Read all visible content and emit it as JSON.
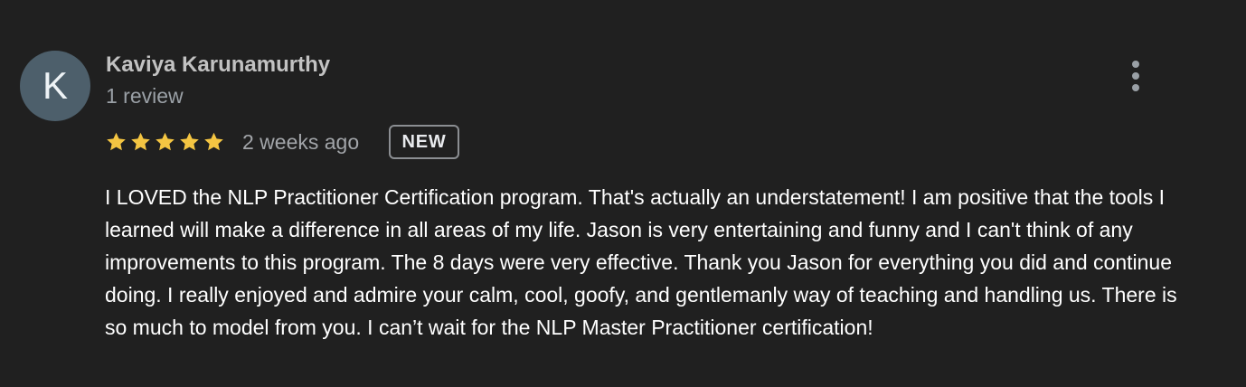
{
  "review": {
    "reviewer": {
      "avatar_letter": "K",
      "name": "Kaviya Karunamurthy",
      "review_count": "1 review"
    },
    "rating": {
      "stars": 5,
      "max_stars": 5,
      "star_color": "#f4c542"
    },
    "date": "2 weeks ago",
    "badge": "NEW",
    "text": "I LOVED the NLP Practitioner Certification program. That's actually an understatement! I am positive that the tools I learned will make a difference in all areas of my life. Jason is very entertaining and funny and I can't think of any improvements to this program. The 8 days were very effective. Thank you Jason for everything you did and continue doing. I really enjoyed and admire your calm, cool, goofy, and gentlemanly way of teaching and handling us. There is so much to model from you. I can’t wait for the NLP Master Practitioner certification!",
    "actions": {
      "more_icon": "more-vert-icon"
    }
  },
  "colors": {
    "background": "#202020",
    "avatar_background": "#4d5f6b",
    "primary_text": "#ffffff",
    "secondary_text": "#9aa0a6"
  }
}
